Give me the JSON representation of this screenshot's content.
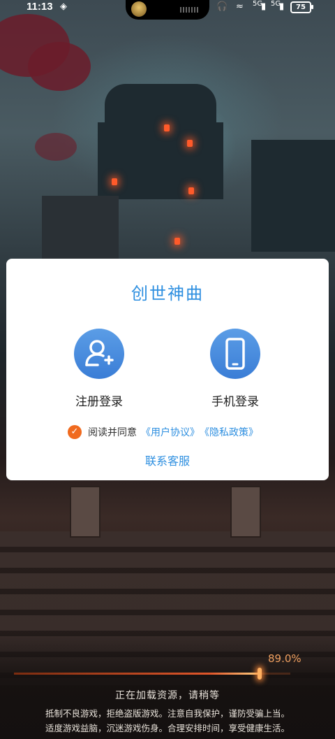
{
  "status_bar": {
    "time": "11:13",
    "network_1": "5G",
    "network_2": "5G",
    "battery": "75"
  },
  "dialog": {
    "title": "创世神曲",
    "register_label": "注册登录",
    "phone_label": "手机登录",
    "agree_text": "阅读并同意",
    "user_agreement": "《用户协议》",
    "privacy_policy": "《隐私政策》",
    "contact": "联系客服",
    "agree_checked": true
  },
  "loading": {
    "progress_text": "89.0%",
    "progress_value": 0.89,
    "status": "正在加载资源，请稍等",
    "notice_line1": "抵制不良游戏，拒绝盗版游戏。注意自我保护，谨防受骗上当。",
    "notice_line2": "适度游戏益脑，沉迷游戏伤身。合理安排时间，享受健康生活。"
  },
  "colors": {
    "accent": "#2e8fe0",
    "check": "#f06a1e",
    "progress": "#e0562a"
  }
}
